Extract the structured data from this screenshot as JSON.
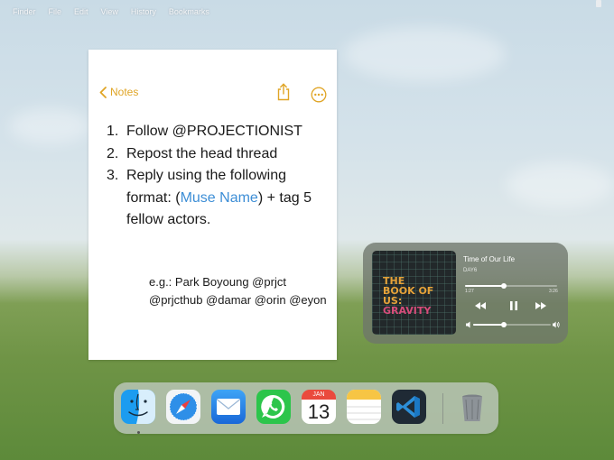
{
  "menubar": {
    "items": [
      "Finder",
      "File",
      "Edit",
      "View",
      "History",
      "Bookmarks"
    ]
  },
  "notes": {
    "back_label": "Notes",
    "icons": {
      "back": "chevron-left-icon",
      "share": "share-icon",
      "more": "ellipsis-circle-icon"
    },
    "steps": [
      {
        "num": "1.",
        "text": "Follow @PROJECTIONIST"
      },
      {
        "num": "2.",
        "text": "Repost the head thread"
      },
      {
        "num": "3.",
        "text_before": "Reply using the following format: (",
        "link": "Muse Name",
        "text_after": ") + tag 5 fellow actors."
      }
    ],
    "example": "e.g.: Park Boyoung @prjct @prjcthub @damar @orin @eyon"
  },
  "player": {
    "album_art": {
      "line1": "THE",
      "line2": "BOOK OF",
      "line3": "US:",
      "line4": "GRAVITY"
    },
    "track_title": "Time of Our Life",
    "artist": "DAY6",
    "elapsed": "1:27",
    "total": "3:26",
    "progress": 0.42,
    "volume": 0.4,
    "icons": {
      "rewind": "backward-icon",
      "pause": "pause-icon",
      "forward": "forward-icon",
      "vol_low": "speaker-low-icon",
      "vol_high": "speaker-high-icon"
    }
  },
  "dock": {
    "apps": [
      {
        "name": "Finder",
        "icon": "finder-icon"
      },
      {
        "name": "Safari",
        "icon": "safari-icon"
      },
      {
        "name": "Mail",
        "icon": "mail-icon"
      },
      {
        "name": "WhatsApp",
        "icon": "whatsapp-icon"
      },
      {
        "name": "Calendar",
        "icon": "calendar-icon",
        "month": "JAN",
        "day": "13"
      },
      {
        "name": "Notes",
        "icon": "notes-icon"
      },
      {
        "name": "Visual Studio Code",
        "icon": "vscode-icon"
      },
      {
        "name": "Trash",
        "icon": "trash-icon"
      }
    ]
  },
  "colors": {
    "notes_accent": "#e0a526",
    "link": "#3d8ed6",
    "calendar_red": "#ea4a3d"
  }
}
